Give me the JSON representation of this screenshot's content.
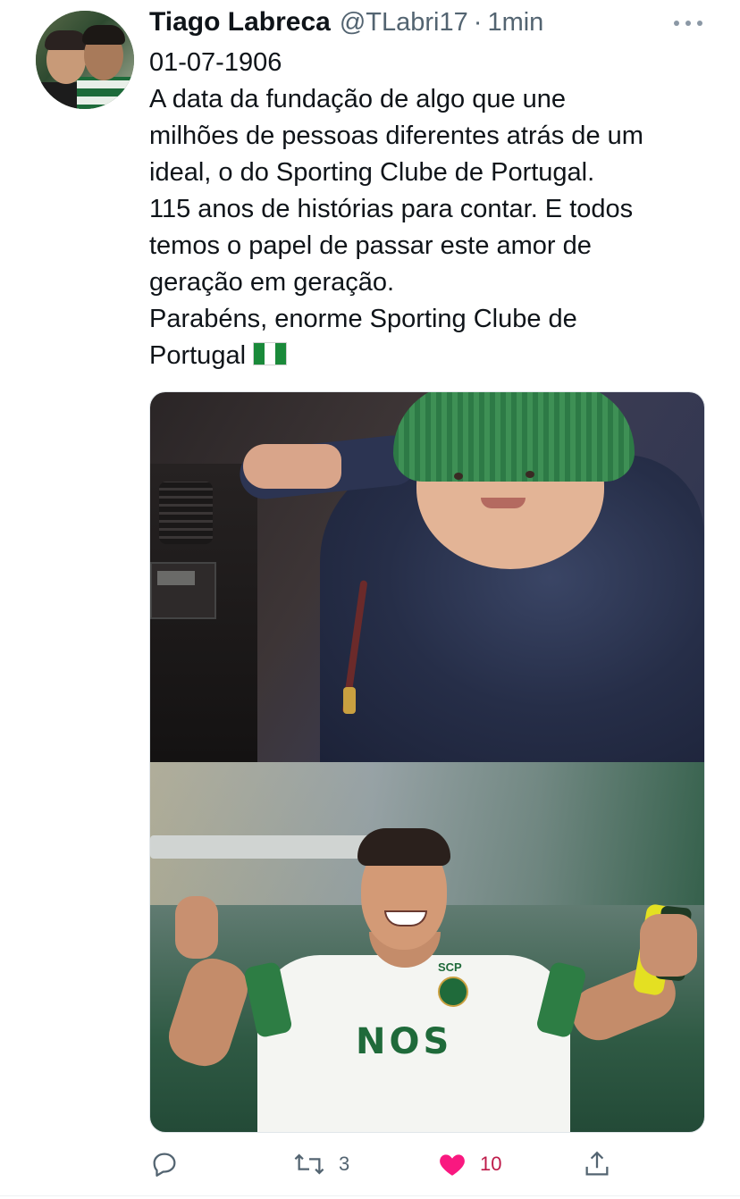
{
  "tweet": {
    "author_name": "Tiago Labreca",
    "handle": "@TLabri17",
    "separator": "·",
    "time": "1min",
    "lines": [
      "01-07-1906",
      "A data da fundação de algo que une",
      "milhões de pessoas diferentes atrás de um",
      "ideal, o do Sporting Clube de Portugal.",
      "115 anos de histórias para contar. E todos",
      "temos o papel de passar este amor de",
      "geração em geração.",
      "Parabéns, enorme Sporting Clube de",
      "Portugal"
    ],
    "flag_emoji": "🇳🇬",
    "media_badge": {
      "shirt_text": "NOS",
      "crest_text": "SCP"
    }
  },
  "actions": {
    "reply": {
      "icon": "reply-icon"
    },
    "retweet": {
      "icon": "retweet-icon",
      "count": "3"
    },
    "like": {
      "icon": "heart-icon",
      "count": "10",
      "liked": true
    },
    "share": {
      "icon": "share-icon"
    }
  },
  "colors": {
    "text": "#0f1419",
    "secondary": "#536471",
    "like": "#f91880",
    "like_count": "#be1a49"
  }
}
